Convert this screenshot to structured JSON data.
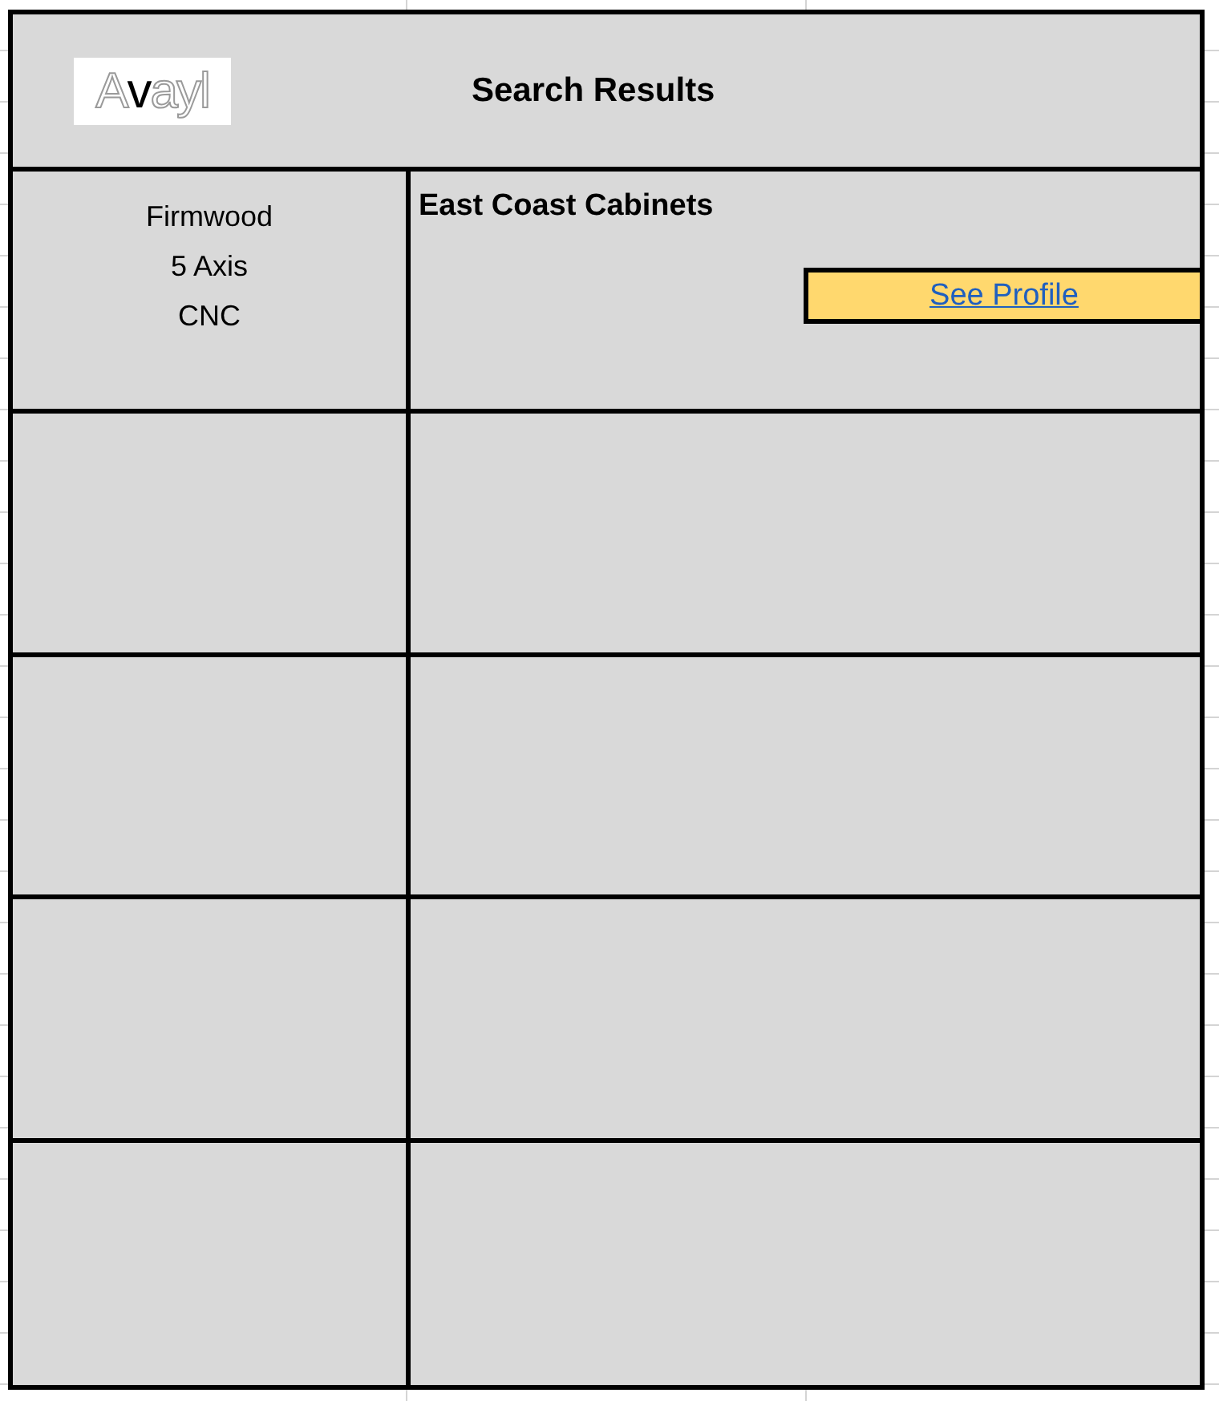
{
  "header": {
    "logo": [
      {
        "text": "A",
        "accent": false
      },
      {
        "text": "v",
        "accent": true
      },
      {
        "text": "ayl",
        "accent": false
      }
    ],
    "title": "Search Results"
  },
  "rows": [
    {
      "details": [
        "Firmwood",
        "5 Axis",
        "CNC"
      ],
      "name": "East Coast Cabinets",
      "action": "See Profile"
    },
    {},
    {},
    {},
    {}
  ]
}
